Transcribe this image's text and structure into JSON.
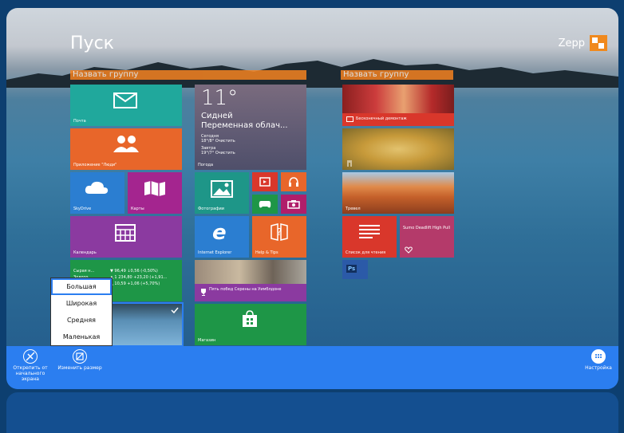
{
  "header": {
    "title": "Пуск",
    "user_name": "Zepp"
  },
  "groups": [
    {
      "label": "Назвать группу"
    },
    {
      "label": "Назвать группу"
    }
  ],
  "tiles": {
    "mail": {
      "label": "Почта"
    },
    "people": {
      "label": "Приложение \"Люди\""
    },
    "skydrive": {
      "label": "SkyDrive"
    },
    "maps": {
      "label": "Карты"
    },
    "calendar": {
      "label": "Календарь"
    },
    "finance": {
      "name": "Сырая н...",
      "name2": "Золото",
      "row1": "▼ 96,49 ↓0,56 (-0,50%)",
      "row2": "▲ 1 234,80 +23,20 (+1,91...",
      "row3": "▲ 10,59 +1,06 (+5,70%)"
    },
    "weather": {
      "temp": "11°",
      "city": "Сидней",
      "condition": "Переменная облач...",
      "today_label": "Сегодня",
      "today_value": "18°/8° Очистить",
      "tomorrow_label": "Завтра",
      "tomorrow_value": "19°/7° Очистить",
      "label": "Погода"
    },
    "photos": {
      "label": "Фотографии"
    },
    "ie": {
      "label": "Internet Explorer"
    },
    "help": {
      "label": "Help & Tips"
    },
    "news": {
      "label": "Пять побед Серены на Уимблдоне"
    },
    "store": {
      "label": "Магазин"
    },
    "demo": {
      "label": "Бесконечный демонтаж"
    },
    "travel": {
      "label": "Тревел"
    },
    "reading": {
      "label": "Список для чтения"
    },
    "health": {
      "title": "Sumo Deadlift High Pull"
    },
    "ps": {
      "label": "Ps"
    }
  },
  "context_menu": {
    "items": [
      "Большая",
      "Широкая",
      "Средняя",
      "Маленькая"
    ],
    "selected": 0
  },
  "appbar": {
    "unpin": "Открепить от начального экрана",
    "resize": "Изменить размер",
    "customize": "Настройка"
  },
  "colors": {
    "accent": "#2b7ef0",
    "group_header": "#f58220",
    "mail": "#20a89c",
    "people": "#e8662a",
    "skydrive": "#2b7ed1",
    "maps": "#a4258f",
    "calendar": "#8b3aa0",
    "finance": "#1e9647"
  }
}
